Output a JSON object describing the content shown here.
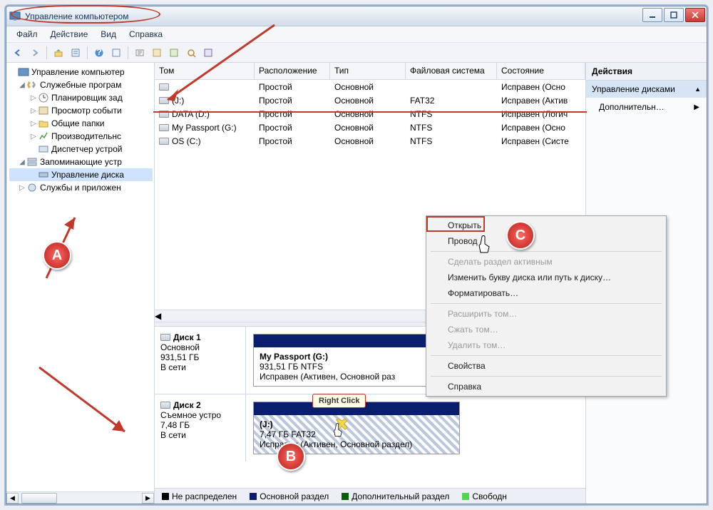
{
  "window": {
    "title": "Управление компьютером"
  },
  "menu": [
    "Файл",
    "Действие",
    "Вид",
    "Справка"
  ],
  "tree": {
    "root": "Управление компьютер",
    "n1": "Служебные програм",
    "n1a": "Планировщик зад",
    "n1b": "Просмотр событи",
    "n1c": "Общие папки",
    "n1d": "Производительнс",
    "n1e": "Диспетчер устрой",
    "n2": "Запоминающие устр",
    "n2a": "Управление диска",
    "n3": "Службы и приложен"
  },
  "cols": {
    "a": "Том",
    "b": "Расположение",
    "c": "Тип",
    "d": "Файловая система",
    "e": "Состояние"
  },
  "vols": [
    {
      "name": "",
      "layout": "Простой",
      "type": "Основной",
      "fs": "",
      "state": "Исправен (Осно"
    },
    {
      "name": "(J:)",
      "layout": "Простой",
      "type": "Основной",
      "fs": "FAT32",
      "state": "Исправен (Актив"
    },
    {
      "name": "DATA (D:)",
      "layout": "Простой",
      "type": "Основной",
      "fs": "NTFS",
      "state": "Исправен (Логич"
    },
    {
      "name": "My Passport (G:)",
      "layout": "Простой",
      "type": "Основной",
      "fs": "NTFS",
      "state": "Исправен (Осно"
    },
    {
      "name": "OS (C:)",
      "layout": "Простой",
      "type": "Основной",
      "fs": "NTFS",
      "state": "Исправен (Систе"
    }
  ],
  "disk1": {
    "name": "Диск 1",
    "kind": "Основной",
    "size": "931,51 ГБ",
    "status": "В сети",
    "part_title": "My Passport  (G:)",
    "part_size": "931,51 ГБ NTFS",
    "part_state": "Исправен (Активен, Основной раз"
  },
  "disk2": {
    "name": "Диск 2",
    "kind": "Съемное устро",
    "size": "7,48 ГБ",
    "status": "В сети",
    "part_title": "(J:)",
    "part_size": "7,47 ГБ FAT32",
    "part_state": "Исправен (Активен, Основной раздел)"
  },
  "legend": {
    "a": "Не распределен",
    "b": "Основной раздел",
    "c": "Дополнительный раздел",
    "d": "Свободн"
  },
  "actions": {
    "head": "Действия",
    "sub": "Управление дисками",
    "more": "Дополнительн…"
  },
  "ctx": {
    "open": "Открыть",
    "explorer": "Провод",
    "active": "Сделать раздел активным",
    "letter": "Изменить букву диска или путь к диску…",
    "format": "Форматировать…",
    "extend": "Расширить том…",
    "shrink": "Сжать том…",
    "delete": "Удалить том…",
    "props": "Свойства",
    "help": "Справка"
  },
  "anno": {
    "rc": "Right Click",
    "A": "A",
    "B": "B",
    "C": "C"
  }
}
